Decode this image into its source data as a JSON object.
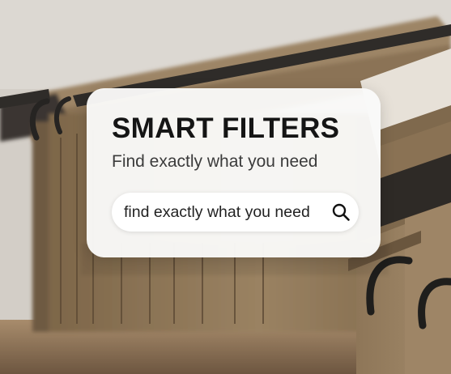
{
  "card": {
    "title": "SMART FILTERS",
    "subtitle": "Find exactly what you need"
  },
  "search": {
    "placeholder": "find exactly what you need",
    "value": "",
    "icon": "search-icon"
  },
  "colors": {
    "folder": "#8a7356",
    "folder_dark": "#6b573f",
    "folder_light": "#a48d6d",
    "hook": "#2b2b2b",
    "background": "#d1ccc5",
    "card": "#fafaf9",
    "title_text": "#151515",
    "subtitle_text": "#3b3b3b"
  }
}
